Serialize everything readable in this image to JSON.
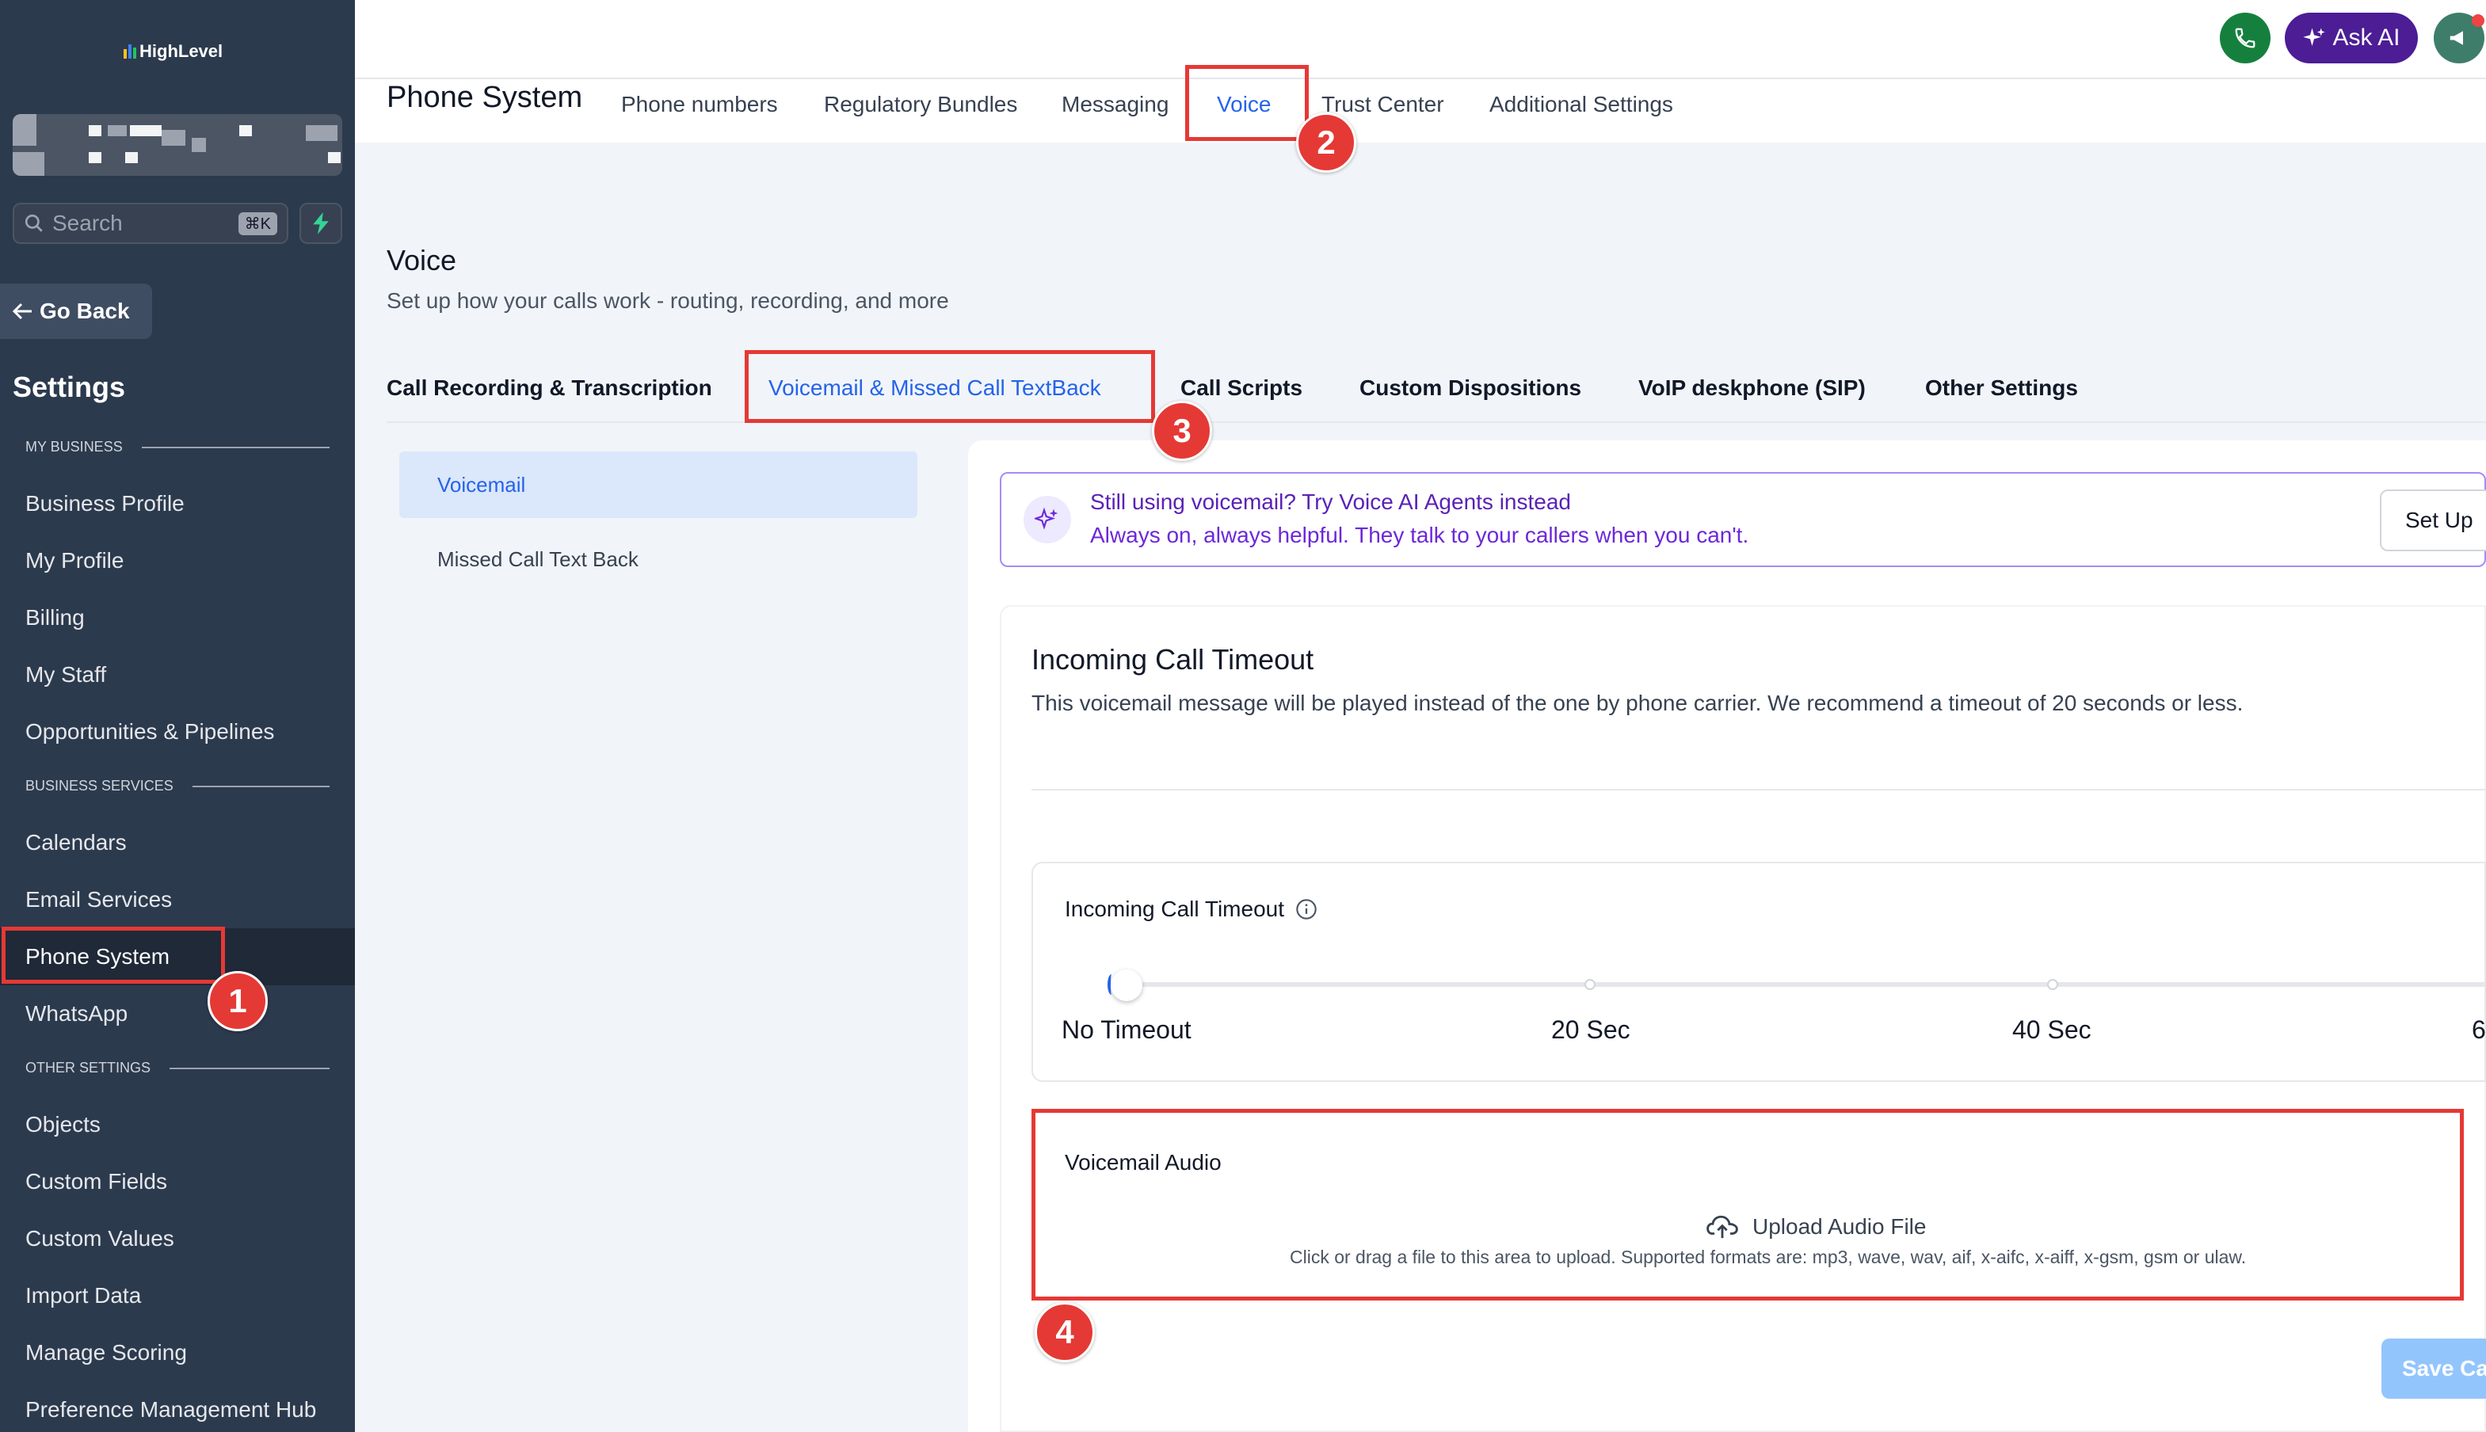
{
  "brand": {
    "name": "HighLevel"
  },
  "sidebar": {
    "search_placeholder": "Search",
    "search_shortcut": "⌘K",
    "go_back": "Go Back",
    "settings_title": "Settings",
    "sections": {
      "my_business": "MY BUSINESS",
      "business_services": "BUSINESS SERVICES",
      "other_settings": "OTHER SETTINGS"
    },
    "items": [
      "Business Profile",
      "My Profile",
      "Billing",
      "My Staff",
      "Opportunities & Pipelines",
      "Calendars",
      "Email Services",
      "Phone System",
      "WhatsApp",
      "Objects",
      "Custom Fields",
      "Custom Values",
      "Import Data",
      "Manage Scoring",
      "Preference Management Hub"
    ],
    "active_item": "Phone System"
  },
  "header": {
    "page_title": "Phone System",
    "tabs": [
      "Phone numbers",
      "Regulatory Bundles",
      "Messaging",
      "Voice",
      "Trust Center",
      "Additional Settings"
    ],
    "active_tab": "Voice",
    "ask_ai": "Ask AI"
  },
  "voice": {
    "title": "Voice",
    "subtitle": "Set up how your calls work - routing, recording, and more",
    "tabs": [
      "Call Recording & Transcription",
      "Voicemail & Missed Call TextBack",
      "Call Scripts",
      "Custom Dispositions",
      "VoIP deskphone (SIP)",
      "Other Settings"
    ],
    "active_tab": "Voicemail & Missed Call TextBack",
    "left_menu": [
      "Voicemail",
      "Missed Call Text Back"
    ],
    "active_left_menu": "Voicemail"
  },
  "banner": {
    "title": "Still using voicemail? Try Voice AI Agents instead",
    "subtitle": "Always on, always helpful. They talk to your callers when you can't.",
    "button": "Set Up"
  },
  "timeout_card": {
    "title": "Incoming Call Timeout",
    "description": "This voicemail message will be played instead of the one by phone carrier. We recommend a timeout of 20 seconds or less.",
    "field_label": "Incoming Call Timeout",
    "ticks": [
      "No Timeout",
      "20 Sec",
      "40 Sec",
      "6"
    ],
    "selected_tick": "No Timeout"
  },
  "voicemail_audio": {
    "label": "Voicemail Audio",
    "upload_title": "Upload Audio File",
    "upload_hint": "Click or drag a file to this area to upload. Supported formats are: mp3, wave, wav, aif, x-aifc, x-aiff, x-gsm, gsm or ulaw."
  },
  "save_button": "Save Ca",
  "annotations": [
    "1",
    "2",
    "3",
    "4"
  ],
  "colors": {
    "sidebar_bg": "#2c3a4e",
    "accent_blue": "#2563eb",
    "annotation_red": "#e53935",
    "ai_purple": "#4c1d95"
  }
}
